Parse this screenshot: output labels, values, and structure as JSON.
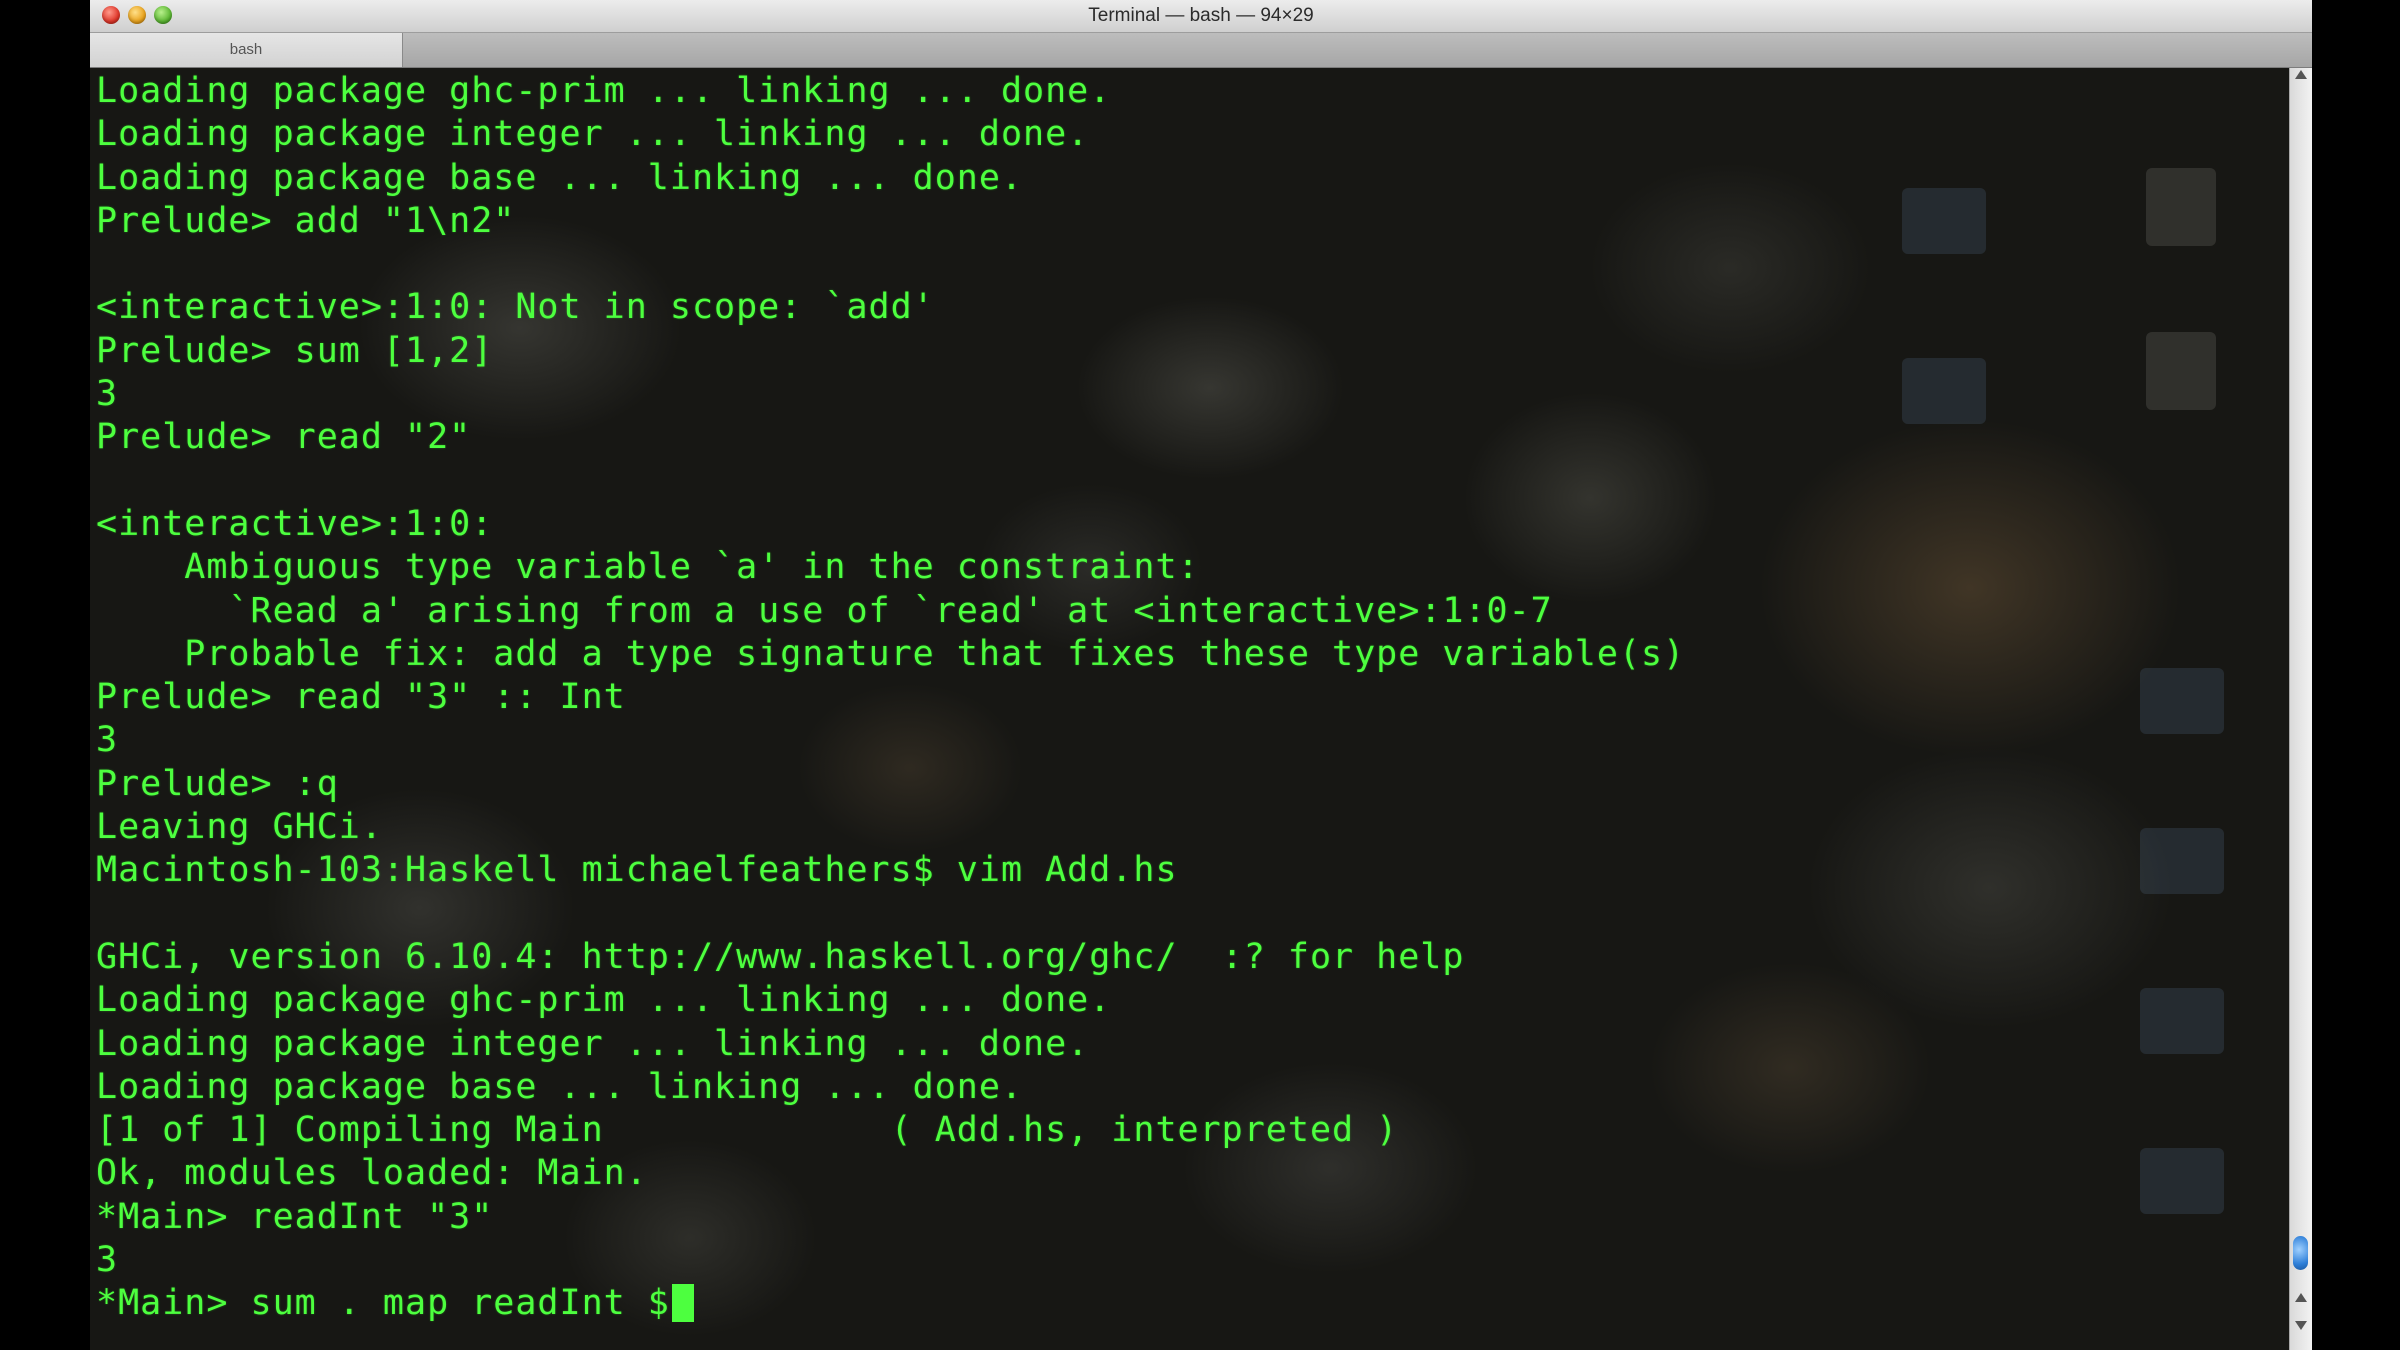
{
  "window": {
    "title": "Terminal — bash — 94×29"
  },
  "tabs": [
    {
      "label": "bash"
    }
  ],
  "colors": {
    "terminal_text": "#4dff3f",
    "title_bar": "#dcdcdc"
  },
  "terminal": {
    "lines": [
      "Loading package ghc-prim ... linking ... done.",
      "Loading package integer ... linking ... done.",
      "Loading package base ... linking ... done.",
      "Prelude> add \"1\\n2\"",
      "",
      "<interactive>:1:0: Not in scope: `add'",
      "Prelude> sum [1,2]",
      "3",
      "Prelude> read \"2\"",
      "",
      "<interactive>:1:0:",
      "    Ambiguous type variable `a' in the constraint:",
      "      `Read a' arising from a use of `read' at <interactive>:1:0-7",
      "    Probable fix: add a type signature that fixes these type variable(s)",
      "Prelude> read \"3\" :: Int",
      "3",
      "Prelude> :q",
      "Leaving GHCi.",
      "Macintosh-103:Haskell michaelfeathers$ vim Add.hs",
      "",
      "GHCi, version 6.10.4: http://www.haskell.org/ghc/  :? for help",
      "Loading package ghc-prim ... linking ... done.",
      "Loading package integer ... linking ... done.",
      "Loading package base ... linking ... done.",
      "[1 of 1] Compiling Main             ( Add.hs, interpreted )",
      "Ok, modules loaded: Main.",
      "*Main> readInt \"3\"",
      "3",
      "*Main> sum . map readInt $"
    ]
  }
}
